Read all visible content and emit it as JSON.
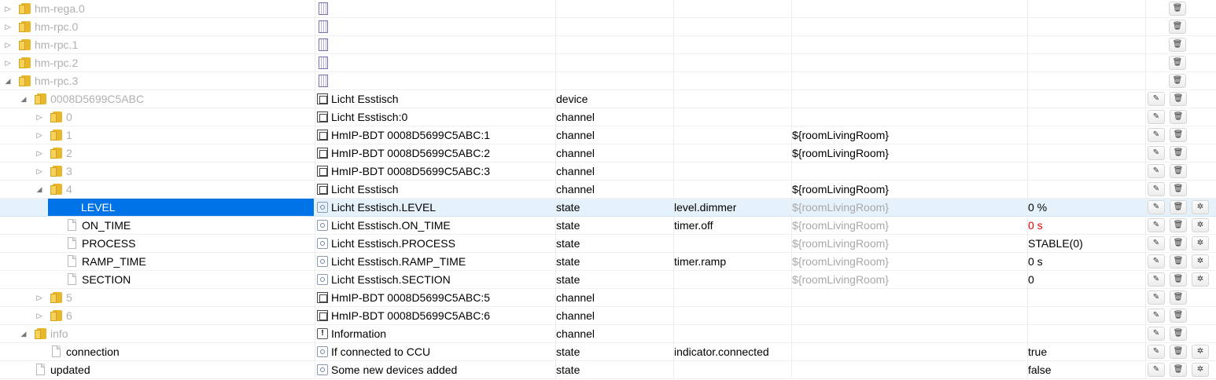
{
  "rows": [
    {
      "id": "hm-rega.0",
      "indent": 0,
      "toggle": "closed",
      "icon": "folder",
      "name_muted": true,
      "nameicon": "adapter-icon",
      "name": "",
      "type": "",
      "role": "",
      "room": "",
      "value": "",
      "buttons": [
        "delete"
      ]
    },
    {
      "id": "hm-rpc.0",
      "indent": 0,
      "toggle": "closed",
      "icon": "folder",
      "name_muted": true,
      "nameicon": "adapter-icon",
      "name": "",
      "type": "",
      "role": "",
      "room": "",
      "value": "",
      "buttons": [
        "delete"
      ]
    },
    {
      "id": "hm-rpc.1",
      "indent": 0,
      "toggle": "closed",
      "icon": "folder",
      "name_muted": true,
      "nameicon": "adapter-icon",
      "name": "",
      "type": "",
      "role": "",
      "room": "",
      "value": "",
      "buttons": [
        "delete"
      ]
    },
    {
      "id": "hm-rpc.2",
      "indent": 0,
      "toggle": "closed",
      "icon": "folder",
      "name_muted": true,
      "nameicon": "adapter-icon",
      "name": "",
      "type": "",
      "role": "",
      "room": "",
      "value": "",
      "buttons": [
        "delete"
      ]
    },
    {
      "id": "hm-rpc.3",
      "indent": 0,
      "toggle": "open",
      "icon": "folder",
      "name_muted": true,
      "nameicon": "adapter-icon",
      "name": "",
      "type": "",
      "role": "",
      "room": "",
      "value": "",
      "buttons": [
        "delete"
      ]
    },
    {
      "id": "0008D5699C5ABC",
      "indent": 1,
      "toggle": "open",
      "icon": "folder",
      "name_muted": true,
      "nameicon": "device-icon",
      "name": "Licht Esstisch",
      "type": "device",
      "role": "",
      "room": "",
      "value": "",
      "buttons": [
        "edit",
        "delete"
      ]
    },
    {
      "id": "0",
      "indent": 2,
      "toggle": "closed",
      "icon": "folder",
      "name_muted": true,
      "nameicon": "device-icon",
      "name": "Licht Esstisch:0",
      "type": "channel",
      "role": "",
      "room": "",
      "value": "",
      "buttons": [
        "edit",
        "delete"
      ]
    },
    {
      "id": "1",
      "indent": 2,
      "toggle": "closed",
      "icon": "folder",
      "name_muted": true,
      "nameicon": "device-icon",
      "name": "HmIP-BDT 0008D5699C5ABC:1",
      "type": "channel",
      "role": "",
      "room": "${roomLivingRoom}",
      "value": "",
      "buttons": [
        "edit",
        "delete"
      ]
    },
    {
      "id": "2",
      "indent": 2,
      "toggle": "closed",
      "icon": "folder",
      "name_muted": true,
      "nameicon": "device-icon",
      "name": "HmIP-BDT 0008D5699C5ABC:2",
      "type": "channel",
      "role": "",
      "room": "${roomLivingRoom}",
      "value": "",
      "buttons": [
        "edit",
        "delete"
      ]
    },
    {
      "id": "3",
      "indent": 2,
      "toggle": "closed",
      "icon": "folder",
      "name_muted": true,
      "nameicon": "device-icon",
      "name": "HmIP-BDT 0008D5699C5ABC:3",
      "type": "channel",
      "role": "",
      "room": "",
      "value": "",
      "buttons": [
        "edit",
        "delete"
      ]
    },
    {
      "id": "4",
      "indent": 2,
      "toggle": "open",
      "icon": "folder",
      "name_muted": true,
      "nameicon": "device-icon",
      "name": "Licht Esstisch",
      "type": "channel",
      "role": "",
      "room": "${roomLivingRoom}",
      "value": "",
      "buttons": [
        "edit",
        "delete"
      ]
    },
    {
      "id": "LEVEL",
      "indent": 3,
      "toggle": "",
      "icon": "file",
      "name_muted": false,
      "selected": true,
      "nameicon": "state-icon",
      "name": "Licht Esstisch.LEVEL",
      "type": "state",
      "role": "level.dimmer",
      "room": "${roomLivingRoom}",
      "room_gray": true,
      "value": "0 %",
      "buttons": [
        "edit",
        "delete",
        "settings"
      ]
    },
    {
      "id": "ON_TIME",
      "indent": 3,
      "toggle": "",
      "icon": "file",
      "name_muted": false,
      "nameicon": "state-icon",
      "name": "Licht Esstisch.ON_TIME",
      "type": "state",
      "role": "timer.off",
      "room": "${roomLivingRoom}",
      "room_gray": true,
      "value": "0 s",
      "value_red": true,
      "buttons": [
        "edit",
        "delete",
        "settings"
      ]
    },
    {
      "id": "PROCESS",
      "indent": 3,
      "toggle": "",
      "icon": "file",
      "name_muted": false,
      "nameicon": "state-icon",
      "name": "Licht Esstisch.PROCESS",
      "type": "state",
      "role": "",
      "room": "${roomLivingRoom}",
      "room_gray": true,
      "value": "STABLE(0)",
      "buttons": [
        "edit",
        "delete",
        "settings"
      ]
    },
    {
      "id": "RAMP_TIME",
      "indent": 3,
      "toggle": "",
      "icon": "file",
      "name_muted": false,
      "nameicon": "state-icon",
      "name": "Licht Esstisch.RAMP_TIME",
      "type": "state",
      "role": "timer.ramp",
      "room": "${roomLivingRoom}",
      "room_gray": true,
      "value": "0 s",
      "buttons": [
        "edit",
        "delete",
        "settings"
      ]
    },
    {
      "id": "SECTION",
      "indent": 3,
      "toggle": "",
      "icon": "file",
      "name_muted": false,
      "nameicon": "state-icon",
      "name": "Licht Esstisch.SECTION",
      "type": "state",
      "role": "",
      "room": "${roomLivingRoom}",
      "room_gray": true,
      "value": "0",
      "buttons": [
        "edit",
        "delete",
        "settings"
      ]
    },
    {
      "id": "5",
      "indent": 2,
      "toggle": "closed",
      "icon": "folder",
      "name_muted": true,
      "nameicon": "device-icon",
      "name": "HmIP-BDT 0008D5699C5ABC:5",
      "type": "channel",
      "role": "",
      "room": "",
      "value": "",
      "buttons": [
        "edit",
        "delete"
      ]
    },
    {
      "id": "6",
      "indent": 2,
      "toggle": "closed",
      "icon": "folder",
      "name_muted": true,
      "nameicon": "device-icon",
      "name": "HmIP-BDT 0008D5699C5ABC:6",
      "type": "channel",
      "role": "",
      "room": "",
      "value": "",
      "buttons": [
        "edit",
        "delete"
      ]
    },
    {
      "id": "info",
      "indent": 1,
      "toggle": "open",
      "icon": "folder",
      "name_muted": true,
      "nameicon": "info-icon",
      "name": "Information",
      "type": "channel",
      "role": "",
      "room": "",
      "value": "",
      "buttons": [
        "edit",
        "delete"
      ]
    },
    {
      "id": "connection",
      "indent": 2,
      "toggle": "",
      "icon": "file",
      "name_muted": false,
      "nameicon": "state-icon",
      "name": "If connected to CCU",
      "type": "state",
      "role": "indicator.connected",
      "room": "",
      "value": "true",
      "buttons": [
        "edit",
        "delete",
        "settings"
      ]
    },
    {
      "id": "updated",
      "indent": 1,
      "toggle": "",
      "icon": "file",
      "name_muted": false,
      "nameicon": "state-icon",
      "name": "Some new devices added",
      "type": "state",
      "role": "",
      "room": "",
      "value": "false",
      "buttons": [
        "edit",
        "delete",
        "settings"
      ]
    }
  ],
  "button_glyphs": {
    "edit": "✎",
    "delete": "🗑",
    "settings": "✲"
  }
}
